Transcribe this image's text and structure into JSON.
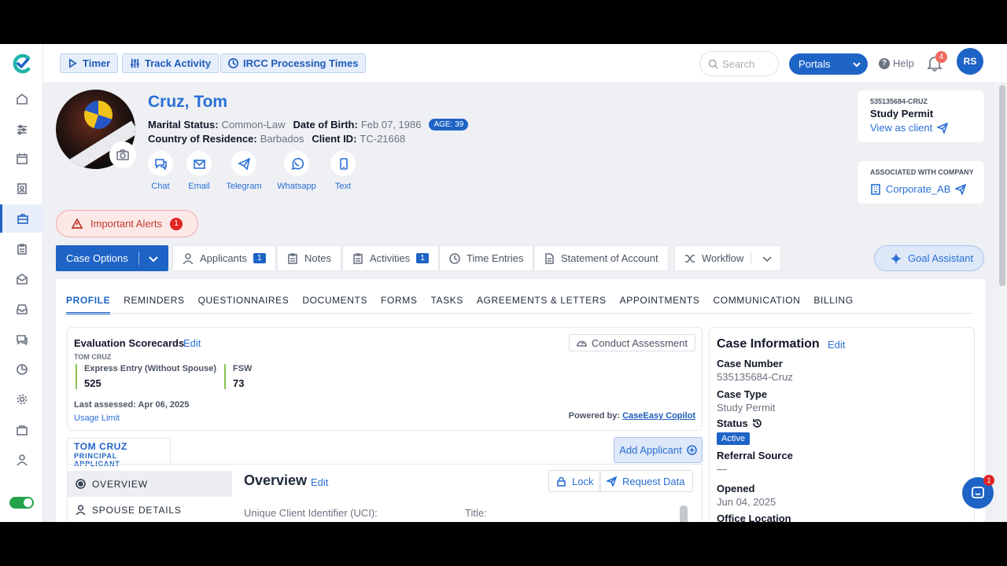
{
  "topbar": {
    "buttons": [
      {
        "label": "Timer",
        "icon": "play-icon"
      },
      {
        "label": "Track Activity",
        "icon": "sliders-icon"
      },
      {
        "label": "IRCC Processing Times",
        "icon": "clock-icon"
      }
    ],
    "search_placeholder": "Search",
    "portals_label": "Portals",
    "help_label": "Help",
    "notification_count": "4",
    "user_initials": "RS"
  },
  "client": {
    "name": "Cruz, Tom",
    "marital_status_label": "Marital Status:",
    "marital_status": "Common-Law",
    "dob_label": "Date of Birth:",
    "dob": "Feb 07, 1986",
    "age_badge": "AGE: 39",
    "country_label": "Country of Residence:",
    "country": "Barbados",
    "client_id_label": "Client ID:",
    "client_id": "TC-21668",
    "comm_actions": [
      "Chat",
      "Email",
      "Telegram",
      "Whatsapp",
      "Text"
    ]
  },
  "case_card": {
    "case_ref": "535135684-CRUZ",
    "permit": "Study Permit",
    "view_as_client": "View as client"
  },
  "company_card": {
    "caption": "ASSOCIATED WITH COMPANY",
    "company": "Corporate_AB"
  },
  "alerts": {
    "label": "Important Alerts",
    "count": "1"
  },
  "toolbar": {
    "case_options": "Case Options",
    "applicants": "Applicants",
    "applicants_count": "1",
    "notes": "Notes",
    "activities": "Activities",
    "activities_count": "1",
    "time_entries": "Time Entries",
    "statement": "Statement of Account",
    "workflow": "Workflow",
    "goal_assistant": "Goal Assistant"
  },
  "subtabs": [
    "PROFILE",
    "REMINDERS",
    "QUESTIONNAIRES",
    "DOCUMENTS",
    "FORMS",
    "TASKS",
    "AGREEMENTS & LETTERS",
    "APPOINTMENTS",
    "COMMUNICATION",
    "BILLING"
  ],
  "evaluation": {
    "title": "Evaluation Scorecards",
    "edit": "Edit",
    "person": "TOM CRUZ",
    "scores": [
      {
        "label": "Express Entry (Without Spouse)",
        "value": "525"
      },
      {
        "label": "FSW",
        "value": "73"
      }
    ],
    "last_assessed": "Last assessed: Apr 06, 2025",
    "usage_limit": "Usage Limit",
    "powered_by": "Powered by:",
    "powered_link": "CaseEasy Copilot",
    "conduct_button": "Conduct Assessment"
  },
  "applicant_tab": {
    "name": "TOM CRUZ",
    "role": "PRINCIPAL APPLICANT"
  },
  "add_applicant": "Add Applicant",
  "overview": {
    "menu": [
      "OVERVIEW",
      "SPOUSE DETAILS"
    ],
    "title": "Overview",
    "edit": "Edit",
    "lock": "Lock",
    "request_data": "Request Data",
    "uci_label": "Unique Client Identifier (UCI):",
    "title_label": "Title:"
  },
  "case_info": {
    "heading": "Case Information",
    "edit": "Edit",
    "case_number_label": "Case Number",
    "case_number": "535135684-Cruz",
    "case_type_label": "Case Type",
    "case_type": "Study Permit",
    "status_label": "Status",
    "status": "Active",
    "referral_label": "Referral Source",
    "referral": "—",
    "opened_label": "Opened",
    "opened": "Jun 04, 2025",
    "office_label": "Office Location"
  },
  "chat_badge": "1",
  "colors": {
    "primary": "#1e63c6",
    "link": "#2a6fd6",
    "alert": "#e02424",
    "success": "#22a34a"
  }
}
